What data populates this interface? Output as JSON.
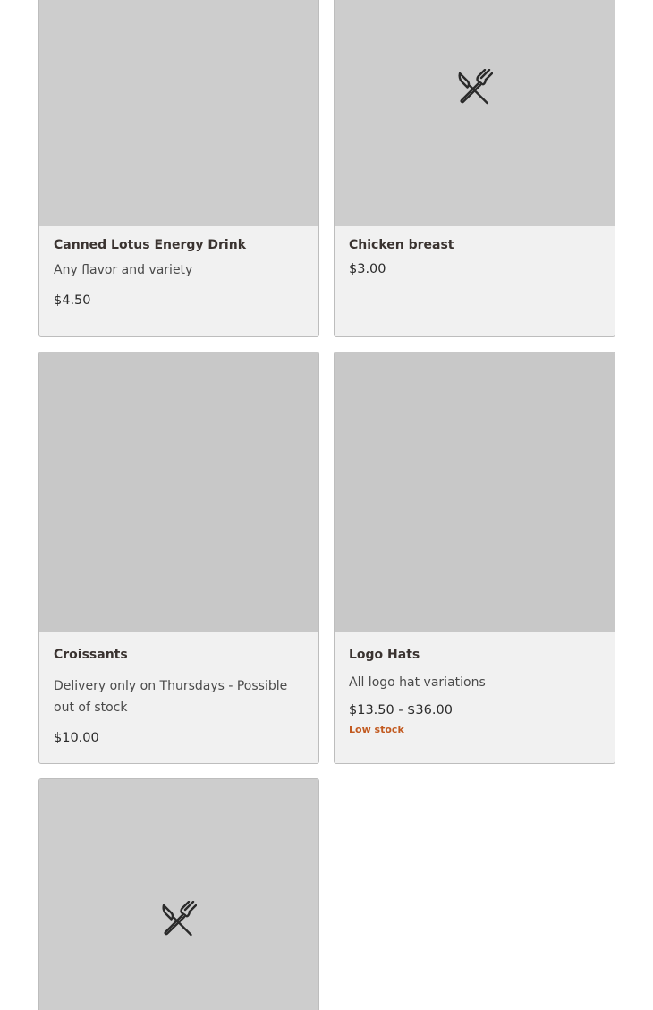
{
  "products": [
    {
      "title": "Canned Lotus Energy Drink",
      "description": "Any flavor and variety",
      "price": "$4.50",
      "image_icon": "none"
    },
    {
      "title": "Chicken breast",
      "price": "$3.00",
      "image_icon": "utensils-icon"
    },
    {
      "title": "Croissants",
      "description": "Delivery only on Thursdays - Possible out of stock",
      "price": "$10.00",
      "image_icon": "none"
    },
    {
      "title": "Logo Hats",
      "description": "All logo hat variations",
      "price": "$13.50 - $36.00",
      "stock_status": "Low stock",
      "image_icon": "none"
    },
    {
      "image_icon": "utensils-icon"
    }
  ],
  "colors": {
    "image_placeholder": "#cdcdcd",
    "card_background": "#f1f1f1",
    "low_stock": "#c25a20"
  }
}
